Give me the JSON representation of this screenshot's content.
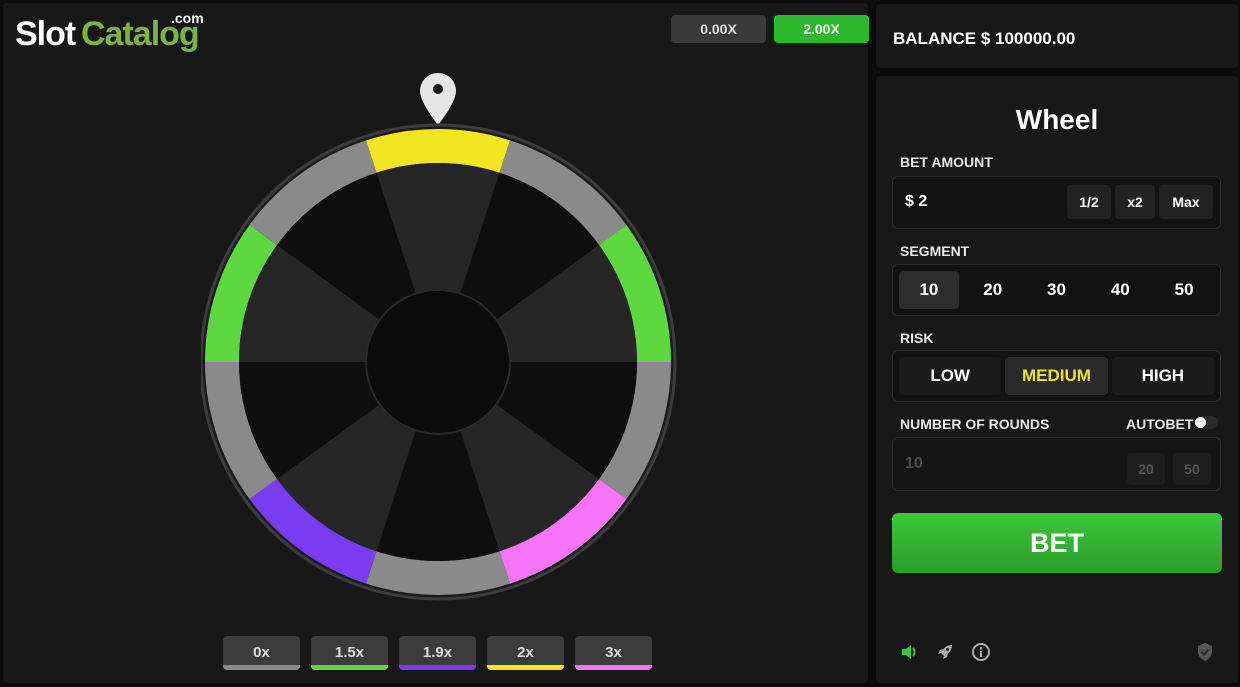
{
  "logo": {
    "slot": "Slot",
    "catalog": "Catalog",
    "com": ".com"
  },
  "history": [
    "0.00X",
    "2.00X"
  ],
  "wheel": {
    "pointer": "map-pin-icon",
    "segment_colors": [
      "#f2e623",
      "#8a8a8a",
      "#5dd83e",
      "#8a8a8a",
      "#f575f5",
      "#8a8a8a",
      "#7a3cf0",
      "#8a8a8a",
      "#5dd83e",
      "#8a8a8a"
    ]
  },
  "legend": [
    {
      "label": "0x",
      "color": "#8a8a8a"
    },
    {
      "label": "1.5x",
      "color": "#5dd83e"
    },
    {
      "label": "1.9x",
      "color": "#7a3cf0"
    },
    {
      "label": "2x",
      "color": "#f2e623"
    },
    {
      "label": "3x",
      "color": "#f575f5"
    }
  ],
  "balance": "BALANCE $ 100000.00",
  "panel": {
    "title": "Wheel",
    "bet_amount_label": "BET AMOUNT",
    "bet_amount_value": "$ 2",
    "bet_buttons": [
      "1/2",
      "x2",
      "Max"
    ],
    "segment_label": "SEGMENT",
    "segments": [
      "10",
      "20",
      "30",
      "40",
      "50"
    ],
    "segment_selected": "10",
    "risk_label": "RISK",
    "risks": [
      "LOW",
      "MEDIUM",
      "HIGH"
    ],
    "risk_selected": "MEDIUM",
    "rounds_label": "NUMBER OF ROUNDS",
    "autobet_label": "AUTOBET",
    "rounds_value": "10",
    "rounds_buttons": [
      "20",
      "50"
    ],
    "bet_button": "BET"
  },
  "footer_icons": [
    "sound-icon",
    "rocket-icon",
    "info-icon",
    "shield-icon"
  ],
  "colors": {
    "accent": "#2eb82e",
    "highlight": "#f2e623"
  }
}
